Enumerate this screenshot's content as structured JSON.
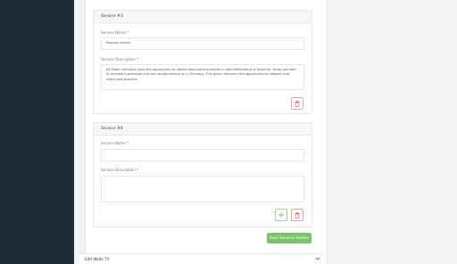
{
  "service3": {
    "header": "Service #3",
    "name_label": "Service Name *",
    "name_value": "Regular events",
    "desc_label": "Service Description *",
    "desc_value": "All Made members have the opportunity to attend best practice events in both Midlands and Yorkshire, these are held at member's premises and are usually weekly on a Thursday. This gives members the opportunity to network and share best practice."
  },
  "service4": {
    "header": "Service #4",
    "name_label": "Service Name *",
    "name_value": "",
    "desc_label": "Service Description *",
    "desc_value": ""
  },
  "actions": {
    "save_label": "Save Services Section",
    "add_icon": "plus-icon",
    "delete_icon": "trash-icon"
  },
  "footer": {
    "label": "Edit Made TV",
    "icon": "chevron-down-icon"
  },
  "colors": {
    "sidebar": "#1f2b35",
    "accent_green": "#79c369",
    "danger_red": "#d9534f"
  }
}
